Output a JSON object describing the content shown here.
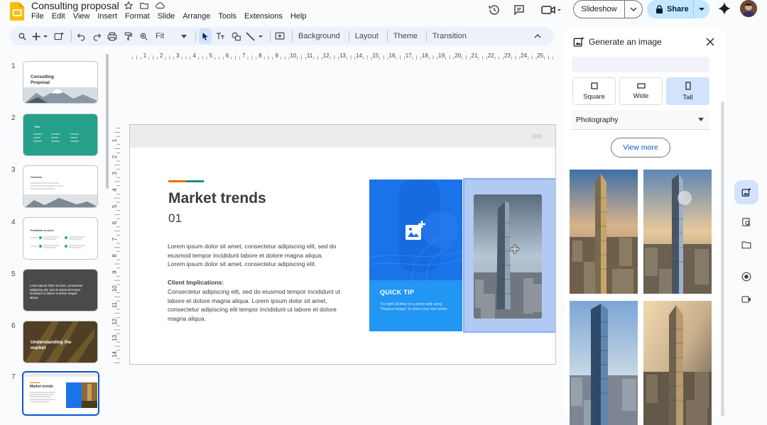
{
  "app": {
    "doc_title": "Consulting proposal",
    "menu": [
      "File",
      "Edit",
      "View",
      "Insert",
      "Format",
      "Slide",
      "Arrange",
      "Tools",
      "Extensions",
      "Help"
    ]
  },
  "header": {
    "slideshow_label": "Slideshow",
    "share_label": "Share"
  },
  "toolbar": {
    "zoom_label": "Fit",
    "background_label": "Background",
    "layout_label": "Layout",
    "theme_label": "Theme",
    "transition_label": "Transition"
  },
  "filmstrip": {
    "slides": [
      {
        "num": "1",
        "title": "Consulting Proposal"
      },
      {
        "num": "2",
        "title": "Plan"
      },
      {
        "num": "3",
        "title": "Overview"
      },
      {
        "num": "4",
        "title": "Problems to solve"
      },
      {
        "num": "5",
        "title": "Lorem ipsum dolor sit amet, consectetur adipiscing elit, sed do eiusmod tempor incididunt ut labore et dolore magna aliqua."
      },
      {
        "num": "6",
        "title": "Understanding the market"
      },
      {
        "num": "7",
        "title": "Market trends"
      }
    ]
  },
  "ruler": {
    "top_labels": [
      "1",
      "2",
      "3",
      "4",
      "5",
      "6",
      "7",
      "8",
      "9",
      "10",
      "11",
      "12",
      "13",
      "14",
      "15",
      "16",
      "17",
      "18",
      "19",
      "20",
      "21",
      "22",
      "23",
      "24",
      "25"
    ],
    "left_labels": [
      "1",
      "2",
      "3",
      "4",
      "5",
      "6",
      "7",
      "8",
      "9",
      "10",
      "11",
      "12",
      "13",
      "14"
    ]
  },
  "slide": {
    "title": "Market trends",
    "number": "01",
    "body": "Lorem ipsum dolor sit amet, consectetur adipiscing elit, sed do eiusmod tempor incididunt labore et dolore magna aliqua. Lorem ipsum dolor sit amet, consectetur adipiscing elit.",
    "subheading": "Client Implications:",
    "body2": "Consectetur adipiscing elit, sed do eiusmod tempor incididunt ut labore et dolore magna aliqua. Lorem ipsum dolor sit amet, consectetur adipiscing elit tempor incididunt ut labore et dolore magna aliqua.",
    "quick_tip_title": "QUICK TIP",
    "quick_tip_text": "Try right clicking on a photo and using \"Replace image\" to show your own photo.",
    "accent_colors": [
      "#e8710a",
      "#1e8e7e"
    ]
  },
  "panel": {
    "title": "Generate an image",
    "prompt_value": "",
    "shapes": [
      {
        "label": "Square",
        "selected": false
      },
      {
        "label": "Wide",
        "selected": false
      },
      {
        "label": "Tall",
        "selected": true
      }
    ],
    "style_value": "Photography",
    "view_more_label": "View more"
  },
  "colors": {
    "accent": "#0b57d0",
    "share_bg": "#c2e7ff",
    "selection": "#d3e3fd"
  }
}
